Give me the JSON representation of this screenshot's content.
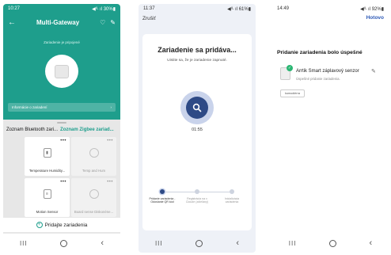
{
  "phone1": {
    "status": {
      "time": "10:27",
      "icons": "◀⁾ᴸ ıl 30%▮"
    },
    "title": "Multi-Gateway",
    "state_text": "Zariadenie je pripojené",
    "info_bar": {
      "label": "Informácie o zariadení",
      "chevron": "›"
    },
    "tabs": {
      "active": "Zoznam Bluetooth zari...",
      "other": "Zoznam Zigbee zariad..."
    },
    "cards": [
      {
        "label": "Temperature Humidity...",
        "dots": "•••",
        "icon": "▮"
      },
      {
        "label": "Temp and Hum",
        "dots": "•••",
        "icon": ""
      },
      {
        "label": "Motion Sensor",
        "dots": "•••",
        "icon": "≡"
      },
      {
        "label": "Board sense  Diskonéne...",
        "dots": "•••",
        "icon": ""
      }
    ],
    "add_button": "Pridajte zariadenia",
    "add_icon": "plus-icon"
  },
  "phone2": {
    "status": {
      "time": "11:37",
      "icons": "◀⁾ᴸ ıl 61%▮"
    },
    "cancel": "Zrušiť",
    "heading": "Zariadenie sa pridáva...",
    "subtitle": "Uistite sa, že je zariadenie zapnuté.",
    "timer": "01:55",
    "steps": [
      {
        "label": "Pridanie zariadenia - Odoslanie QR kód"
      },
      {
        "label": "Registrácia na v Cloude (zdieľaný)"
      },
      {
        "label": "Inicializácia zariadenia"
      }
    ],
    "accent": "#2e4a86"
  },
  "phone3": {
    "status": {
      "time": "14:49",
      "icons": "◀⁾ᴸ ıl 92%▮"
    },
    "done": "Hotovo",
    "heading": "Pridanie zariadenia bolo úspešné",
    "device_name": "Arrtik Smart záplavový senzor",
    "device_sub": "Úspešné pridanie zariadenia.",
    "sub_button": "kumodiérra",
    "accent": "#2e5ab7"
  },
  "nav": {
    "recent": "III",
    "back": "‹"
  }
}
